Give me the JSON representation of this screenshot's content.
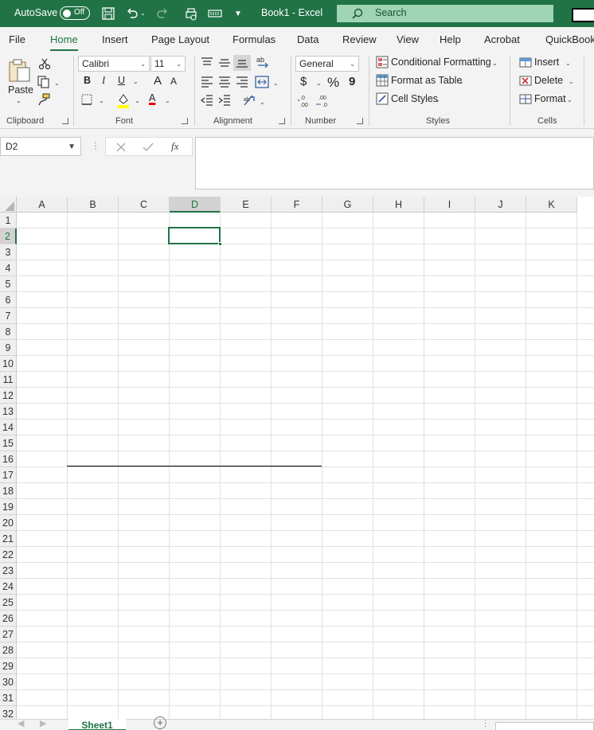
{
  "titlebar": {
    "autosave_label": "AutoSave",
    "autosave_state": "Off",
    "title": "Book1  -  Excel",
    "search_placeholder": "Search",
    "icons": [
      "save-icon",
      "undo-icon",
      "redo-icon",
      "quick-print-icon",
      "touch-mode-icon",
      "customize-qat-icon",
      "search-icon"
    ]
  },
  "tabs": [
    "File",
    "Home",
    "Insert",
    "Page Layout",
    "Formulas",
    "Data",
    "Review",
    "View",
    "Help",
    "Acrobat",
    "QuickBooks"
  ],
  "active_tab": "Home",
  "ribbon": {
    "clipboard": {
      "label": "Clipboard",
      "paste": "Paste"
    },
    "font": {
      "label": "Font",
      "font_name": "Calibri",
      "font_size": "11",
      "bold": "B",
      "italic": "I",
      "underline": "U",
      "grow": "A",
      "shrink": "A",
      "font_color_letter": "A"
    },
    "alignment": {
      "label": "Alignment"
    },
    "number": {
      "label": "Number",
      "format": "General",
      "currency": "$",
      "percent": "%",
      "comma": "9"
    },
    "styles": {
      "label": "Styles",
      "conditional": "Conditional Formatting",
      "format_table": "Format as Table",
      "cell_styles": "Cell Styles"
    },
    "cells": {
      "label": "Cells",
      "insert": "Insert",
      "delete": "Delete",
      "format": "Format"
    }
  },
  "formula_bar": {
    "name_box": "D2",
    "fx": "fx",
    "value": ""
  },
  "columns": [
    "A",
    "B",
    "C",
    "D",
    "E",
    "F",
    "G",
    "H",
    "I",
    "J",
    "K"
  ],
  "rows": [
    "1",
    "2",
    "3",
    "4",
    "5",
    "6",
    "7",
    "8",
    "9",
    "10",
    "11",
    "12",
    "13",
    "14",
    "15",
    "16",
    "17",
    "18",
    "19",
    "20",
    "21",
    "22",
    "23",
    "24",
    "25",
    "26",
    "27",
    "28",
    "29",
    "30",
    "31",
    "32"
  ],
  "selected_cell": "D2",
  "sheets": [
    "Sheet1"
  ],
  "colors": {
    "excel_green": "#217346",
    "search_bg": "#9fd5b3"
  }
}
